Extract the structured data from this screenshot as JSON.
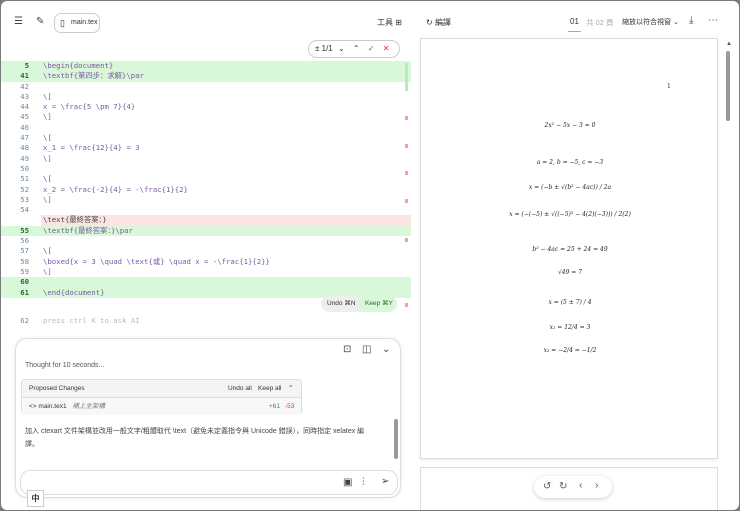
{
  "topbar": {
    "file_tab": "main.tex",
    "tools_label": "工具",
    "compile_label": "編譯",
    "page_current": "01",
    "page_total": "共 02 頁",
    "zoom_select": "縮放以符合視窗"
  },
  "diff_nav": {
    "count": "± 1/1"
  },
  "code_lines": [
    {
      "n": "5",
      "t": "\\begin{document}",
      "type": "add"
    },
    {
      "n": "41",
      "t": "\\textbf{第四步：求解}\\par",
      "type": "add"
    },
    {
      "n": "42",
      "t": "",
      "type": ""
    },
    {
      "n": "43",
      "t": "\\[",
      "type": ""
    },
    {
      "n": "44",
      "t": "x = \\frac{5 \\pm 7}{4}",
      "type": ""
    },
    {
      "n": "45",
      "t": "\\]",
      "type": ""
    },
    {
      "n": "46",
      "t": "",
      "type": ""
    },
    {
      "n": "47",
      "t": "\\[",
      "type": ""
    },
    {
      "n": "48",
      "t": "x_1 = \\frac{12}{4} = 3",
      "type": ""
    },
    {
      "n": "49",
      "t": "\\]",
      "type": ""
    },
    {
      "n": "50",
      "t": "",
      "type": ""
    },
    {
      "n": "51",
      "t": "\\[",
      "type": ""
    },
    {
      "n": "52",
      "t": "x_2 = \\frac{-2}{4} = -\\frac{1}{2}",
      "type": ""
    },
    {
      "n": "53",
      "t": "\\]",
      "type": ""
    },
    {
      "n": "54",
      "t": "",
      "type": ""
    },
    {
      "n": "",
      "t": "\\text{最終答案：}",
      "type": "del"
    },
    {
      "n": "55",
      "t": "\\textbf{最終答案：}\\par",
      "type": "add"
    },
    {
      "n": "56",
      "t": "",
      "type": ""
    },
    {
      "n": "57",
      "t": "\\[",
      "type": ""
    },
    {
      "n": "58",
      "t": "\\boxed{x = 3 \\quad \\text{或} \\quad x = -\\frac{1}{2}}",
      "type": ""
    },
    {
      "n": "59",
      "t": "\\]",
      "type": ""
    },
    {
      "n": "60",
      "t": "",
      "type": "add"
    },
    {
      "n": "61",
      "t": "\\end{document}",
      "type": "add"
    }
  ],
  "hunk": {
    "undo": "Undo ⌘N",
    "keep": "Keep ⌘Y"
  },
  "ai_line": {
    "n": "62",
    "placeholder": "press ctrl K to ask AI"
  },
  "chat": {
    "thought": "Thought for 10 seconds...",
    "proposed": {
      "title": "Proposed Changes",
      "undo_all": "Undo all",
      "keep_all": "Keep all",
      "file": "main.tex1",
      "file_note": "補上主架構",
      "added": "+61",
      "removed": "-53"
    },
    "message": "加入 ctexart 文件架構並改用一般文字/粗體取代 \\text（避免未定義指令與 Unicode 錯誤），同時指定 xelatex 編譯。",
    "ime": "中"
  },
  "preview": {
    "page_number": "1",
    "equations": [
      "2x² − 5x − 3 = 0",
      "a = 2,   b = −5,   c = −3",
      "x = (−b ± √(b² − 4ac)) / 2a",
      "x = (−(−5) ± √((−5)² − 4(2)(−3))) / 2(2)",
      "b² − 4ac = 25 + 24 = 49",
      "√49 = 7",
      "x = (5 ± 7) / 4",
      "x₁ = 12/4 = 3",
      "x₂ = −2/4 = −1/2"
    ]
  },
  "colors": {
    "added": "#d9f7d9",
    "removed": "#fde4e4",
    "accent_green": "#2e9a3e",
    "accent_red": "#d33"
  }
}
